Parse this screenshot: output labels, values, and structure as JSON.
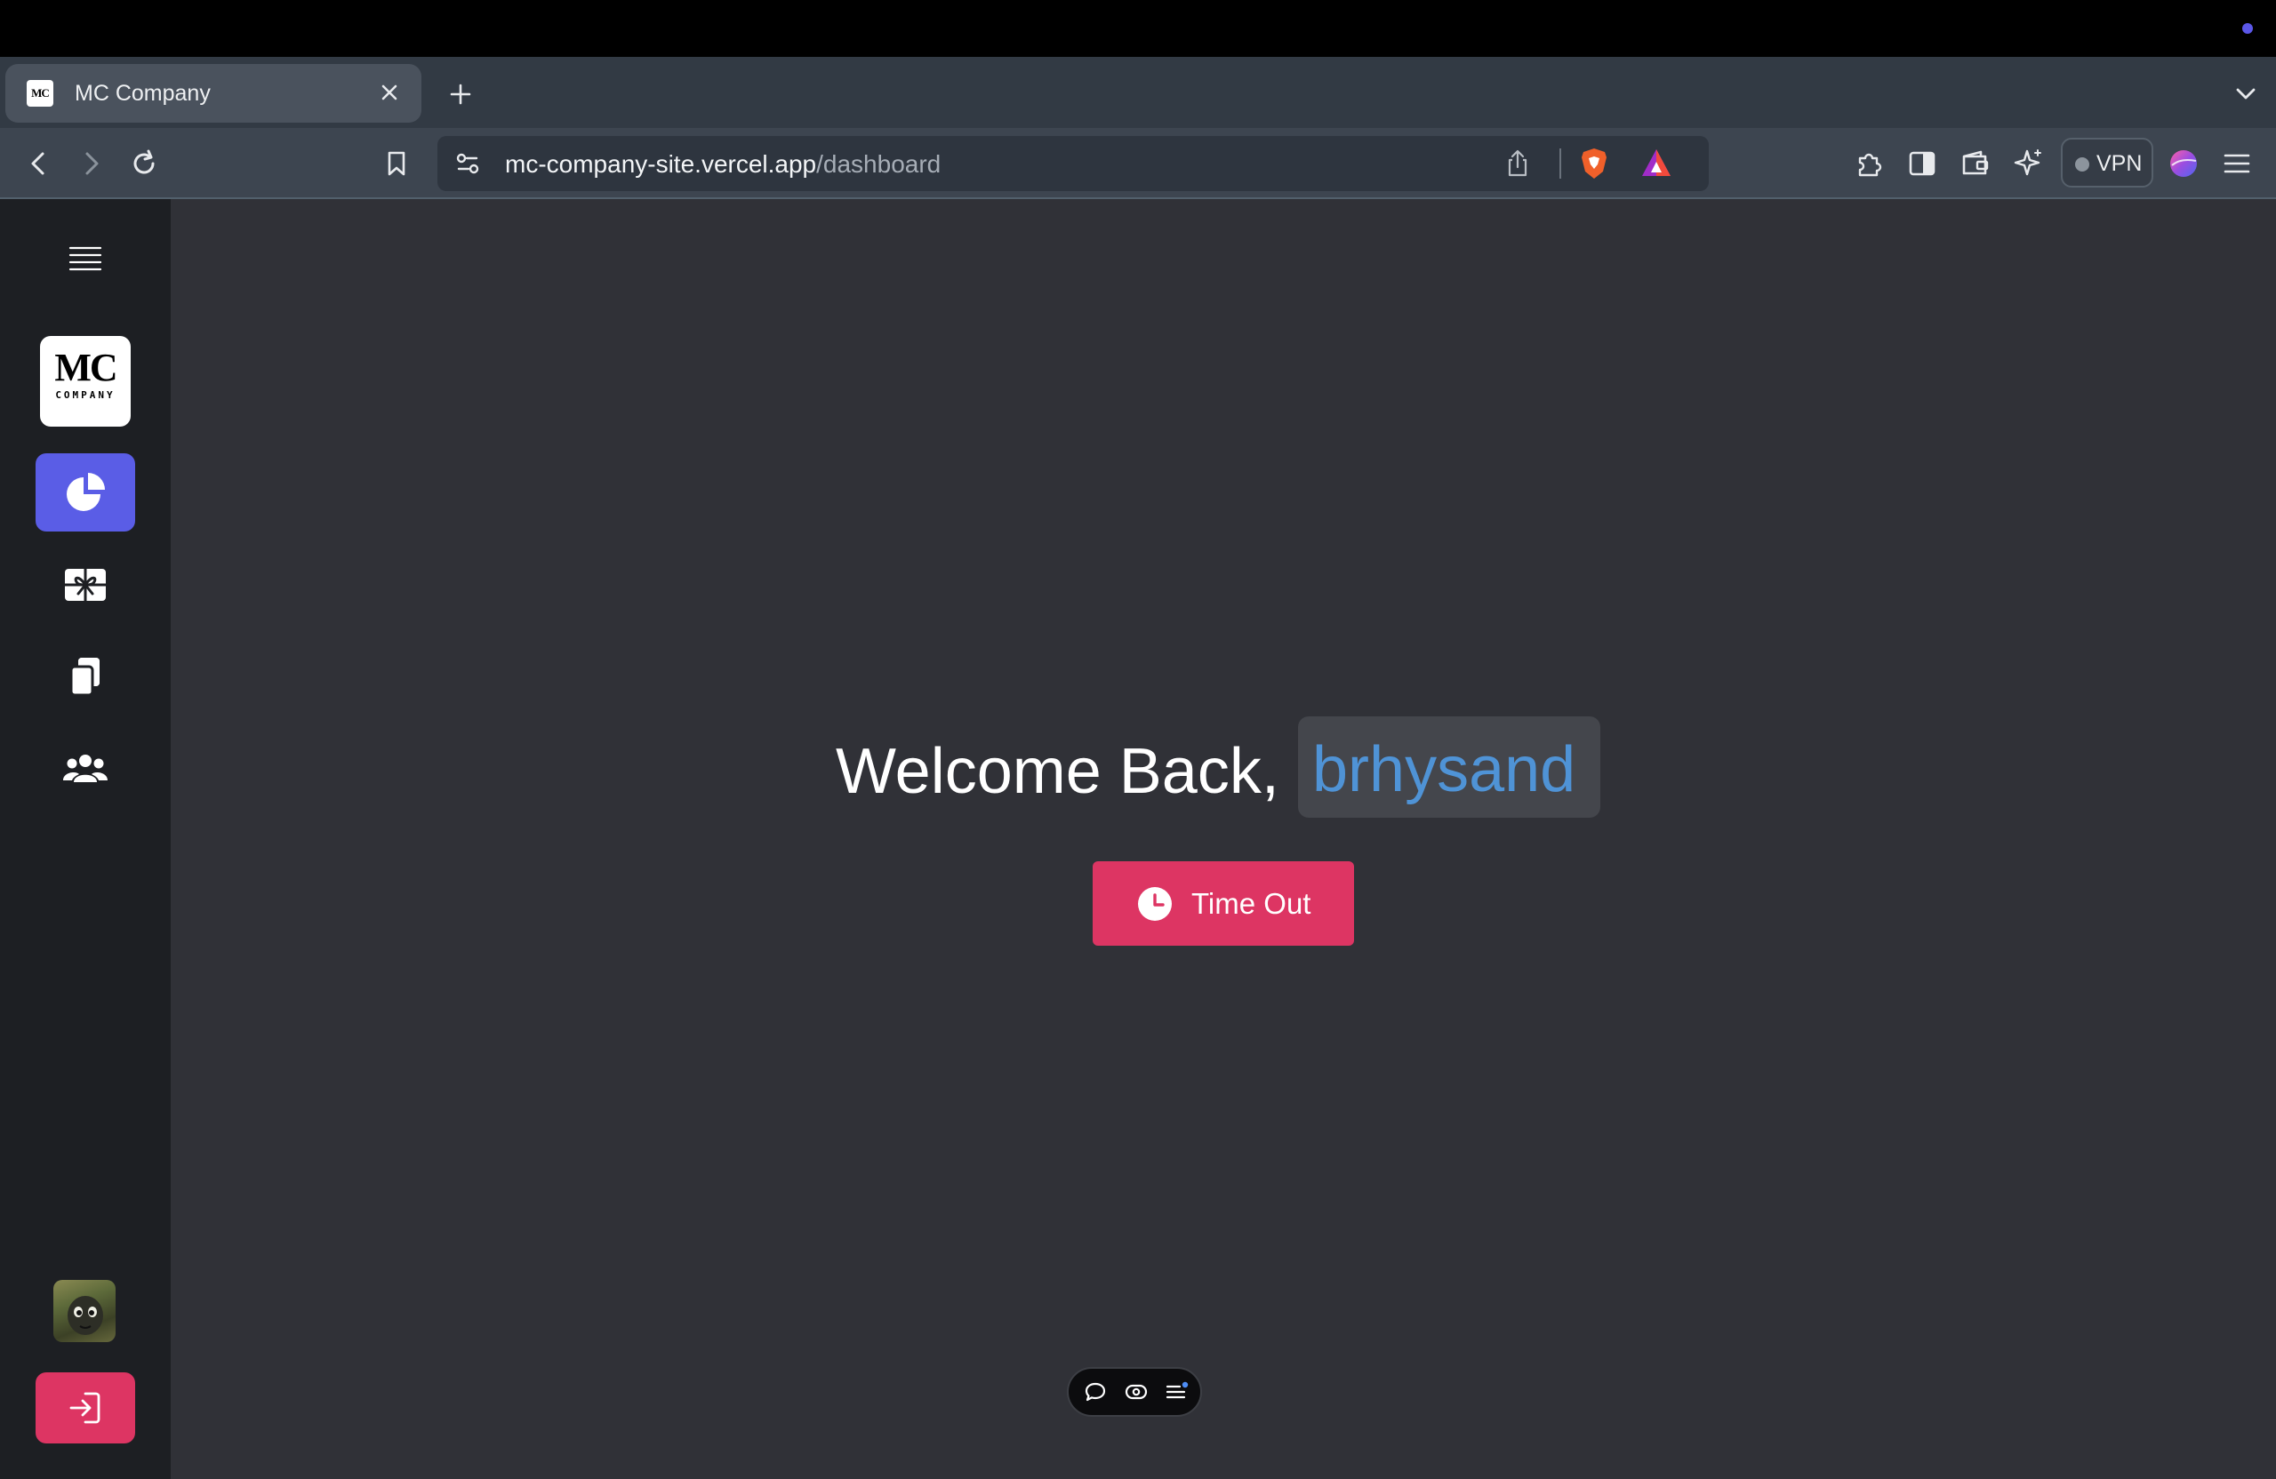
{
  "browser": {
    "tab": {
      "favicon_text": "MC",
      "title": "MC Company"
    },
    "url": {
      "host": "mc-company-site.vercel.app",
      "path": "/dashboard"
    },
    "vpn_label": "VPN",
    "icons": [
      "back-icon",
      "forward-icon",
      "reload-icon",
      "bookmark-icon",
      "site-settings-icon",
      "share-icon",
      "brave-shields-icon",
      "brave-rewards-icon",
      "extensions-icon",
      "sidebar-icon",
      "wallet-icon",
      "leo-ai-icon",
      "profile-icon",
      "menu-icon"
    ]
  },
  "sidebar": {
    "logo": {
      "mc": "MC",
      "company": "COMPANY"
    },
    "items": [
      {
        "name": "dashboard",
        "icon": "pie-chart-icon",
        "active": true
      },
      {
        "name": "gifts",
        "icon": "gift-icon",
        "active": false
      },
      {
        "name": "documents",
        "icon": "copy-icon",
        "active": false
      },
      {
        "name": "team",
        "icon": "users-icon",
        "active": false
      }
    ],
    "logout_icon": "sign-in-icon"
  },
  "main": {
    "welcome_prefix": "Welcome Back,",
    "username": "brhysand",
    "timeout_label": "Time Out"
  },
  "colors": {
    "accent": "#5a5de6",
    "danger": "#dd3563",
    "username": "#4f93d6",
    "main_bg": "#303137",
    "sidebar_bg": "#1d1f23"
  }
}
